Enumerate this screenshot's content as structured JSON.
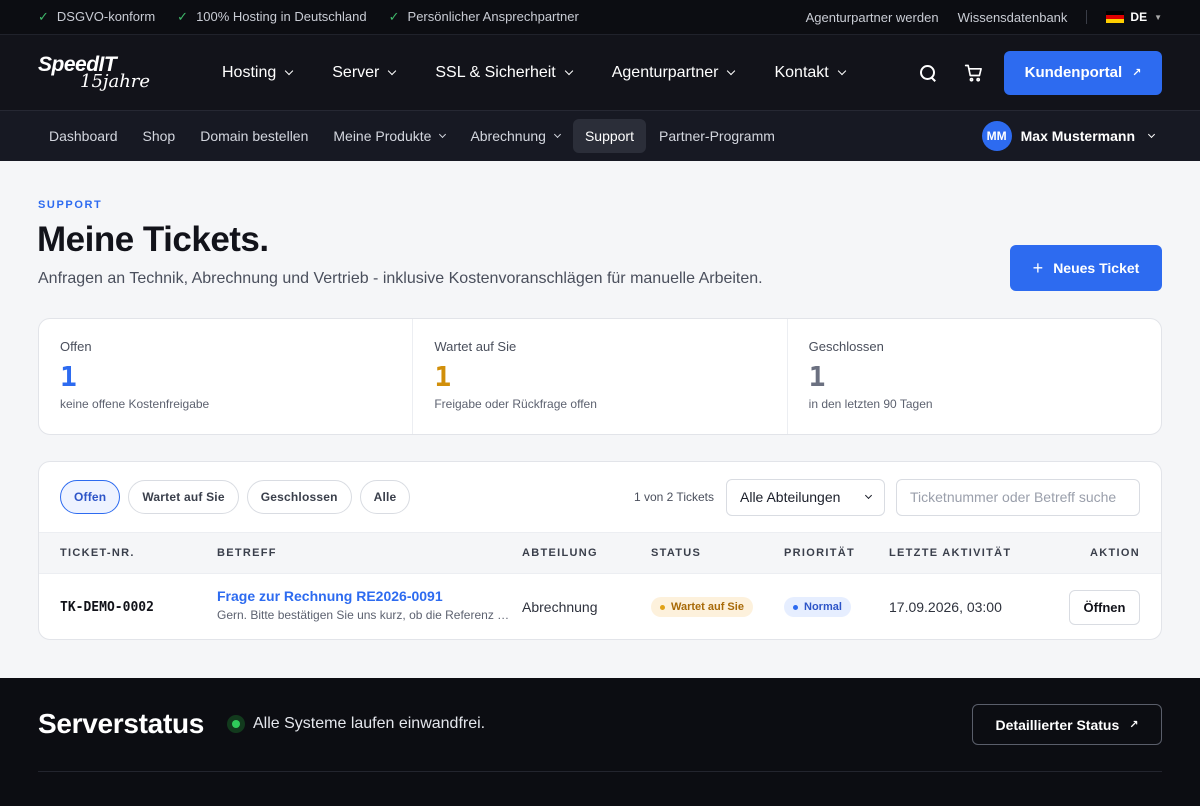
{
  "topbar": {
    "badges": [
      "DSGVO-konform",
      "100% Hosting in Deutschland",
      "Persönlicher Ansprechpartner"
    ],
    "links": [
      "Agenturpartner werden",
      "Wissensdatenbank"
    ],
    "language": "DE"
  },
  "brand": {
    "name": "SpeedIT",
    "tagline": "15jahre"
  },
  "mainnav": {
    "items": [
      "Hosting",
      "Server",
      "SSL & Sicherheit",
      "Agenturpartner",
      "Kontakt"
    ],
    "portal_label": "Kundenportal"
  },
  "subnav": {
    "items": [
      "Dashboard",
      "Shop",
      "Domain bestellen",
      "Meine Produkte",
      "Abrechnung",
      "Support",
      "Partner-Programm"
    ],
    "active": "Support",
    "user_initials": "MM",
    "user_name": "Max Mustermann"
  },
  "page": {
    "eyebrow": "SUPPORT",
    "title": "Meine Tickets.",
    "subtitle": "Anfragen an Technik, Abrechnung und Vertrieb - inklusive Kostenvoranschlägen für manuelle Arbeiten.",
    "new_ticket_label": "Neues Ticket"
  },
  "stats": [
    {
      "label": "Offen",
      "value": "1",
      "hint": "keine offene Kostenfreigabe",
      "color": "#2d6bf0"
    },
    {
      "label": "Wartet auf Sie",
      "value": "1",
      "hint": "Freigabe oder Rückfrage offen",
      "color": "#d18f0a"
    },
    {
      "label": "Geschlossen",
      "value": "1",
      "hint": "in den letzten 90 Tagen",
      "color": "#6b7080"
    }
  ],
  "filters": {
    "pills": [
      "Offen",
      "Wartet auf Sie",
      "Geschlossen",
      "Alle"
    ],
    "active": "Offen",
    "count": "1 von 2 Tickets",
    "department_select": "Alle Abteilungen",
    "search_placeholder": "Ticketnummer oder Betreff suche"
  },
  "table": {
    "headers": [
      "TICKET-NR.",
      "BETREFF",
      "ABTEILUNG",
      "STATUS",
      "PRIORITÄT",
      "LETZTE AKTIVITÄT",
      "AKTION"
    ],
    "rows": [
      {
        "id": "TK-DEMO-0002",
        "subject": "Frage zur Rechnung RE2026-0091",
        "excerpt": "Gern. Bitte bestätigen Sie uns kurz, ob die Referenz a...",
        "department": "Abrechnung",
        "status": "Wartet auf Sie",
        "priority": "Normal",
        "last_activity": "17.09.2026, 03:00",
        "action": "Öffnen"
      }
    ]
  },
  "footer": {
    "title": "Serverstatus",
    "status_text": "Alle Systeme laufen einwandfrei.",
    "detail_label": "Detaillierter Status"
  },
  "colors": {
    "accent": "#2d6bf0",
    "warning": "#d18f0a",
    "ok": "#2fcb5a",
    "dark": "#0c0d12"
  }
}
